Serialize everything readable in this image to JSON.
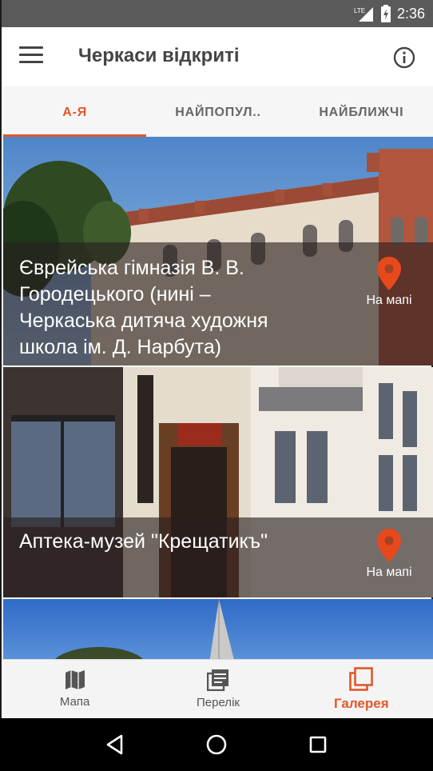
{
  "status_bar": {
    "time": "2:36",
    "network": "LTE"
  },
  "app_bar": {
    "title": "Черкаси відкриті"
  },
  "tabs": [
    {
      "label": "А-Я",
      "active": true
    },
    {
      "label": "НАЙПОПУЛ..",
      "active": false
    },
    {
      "label": "НАЙБЛИЖЧІ",
      "active": false
    }
  ],
  "cards": [
    {
      "title": "Єврейська гімназія В. В. Городецького (нині – Черкаська дитяча художня школа ім. Д. Нарбута)",
      "map_label": "На мапі"
    },
    {
      "title": "Аптека-музей \"Крещатикъ\"",
      "map_label": "На мапі"
    }
  ],
  "bottom_nav": [
    {
      "label": "Мапа",
      "icon": "map-icon"
    },
    {
      "label": "Перелік",
      "icon": "list-icon"
    },
    {
      "label": "Галерея",
      "icon": "gallery-icon",
      "active": true
    }
  ],
  "colors": {
    "accent": "#e3572b",
    "pin": "#e8491c"
  }
}
